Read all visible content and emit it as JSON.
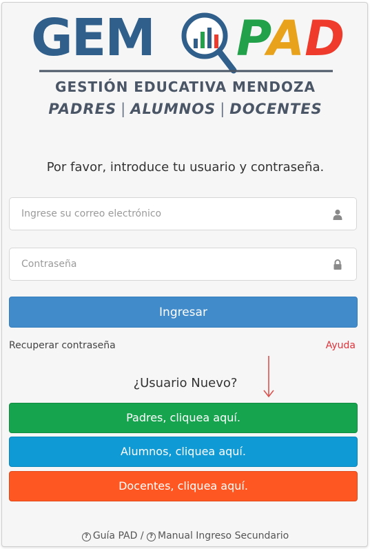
{
  "logo": {
    "gem": "GEM",
    "pad": "PAD",
    "subtitle": "GESTIÓN EDUCATIVA MENDOZA",
    "role_padres": "PADRES",
    "role_alumnos": "ALUMNOS",
    "role_docentes": "DOCENTES",
    "colors": {
      "gem": "#2f5f8a",
      "pad_p": "#22a04a",
      "pad_a": "#e8a21c",
      "pad_d": "#ee3b2b"
    }
  },
  "login": {
    "prompt": "Por favor, introduce tu usuario y contraseña.",
    "email_placeholder": "Ingrese su correo electrónico",
    "email_icon": "user-icon",
    "password_placeholder": "Contraseña",
    "password_icon": "lock-icon",
    "submit_label": "Ingresar",
    "recover_label": "Recuperar contraseña",
    "help_label": "Ayuda"
  },
  "register": {
    "title": "¿Usuario Nuevo?",
    "padres_label": "Padres, cliquea aquí.",
    "alumnos_label": "Alumnos, cliquea aquí.",
    "docentes_label": "Docentes, cliquea aquí."
  },
  "footer": {
    "guide_label": "Guía PAD",
    "separator": "/",
    "manual_label": "Manual Ingreso Secundario"
  },
  "colors": {
    "primary": "#428bca",
    "padres": "#17a44f",
    "alumnos": "#0f9ad6",
    "docentes": "#ff5722",
    "help": "#e0333a"
  }
}
